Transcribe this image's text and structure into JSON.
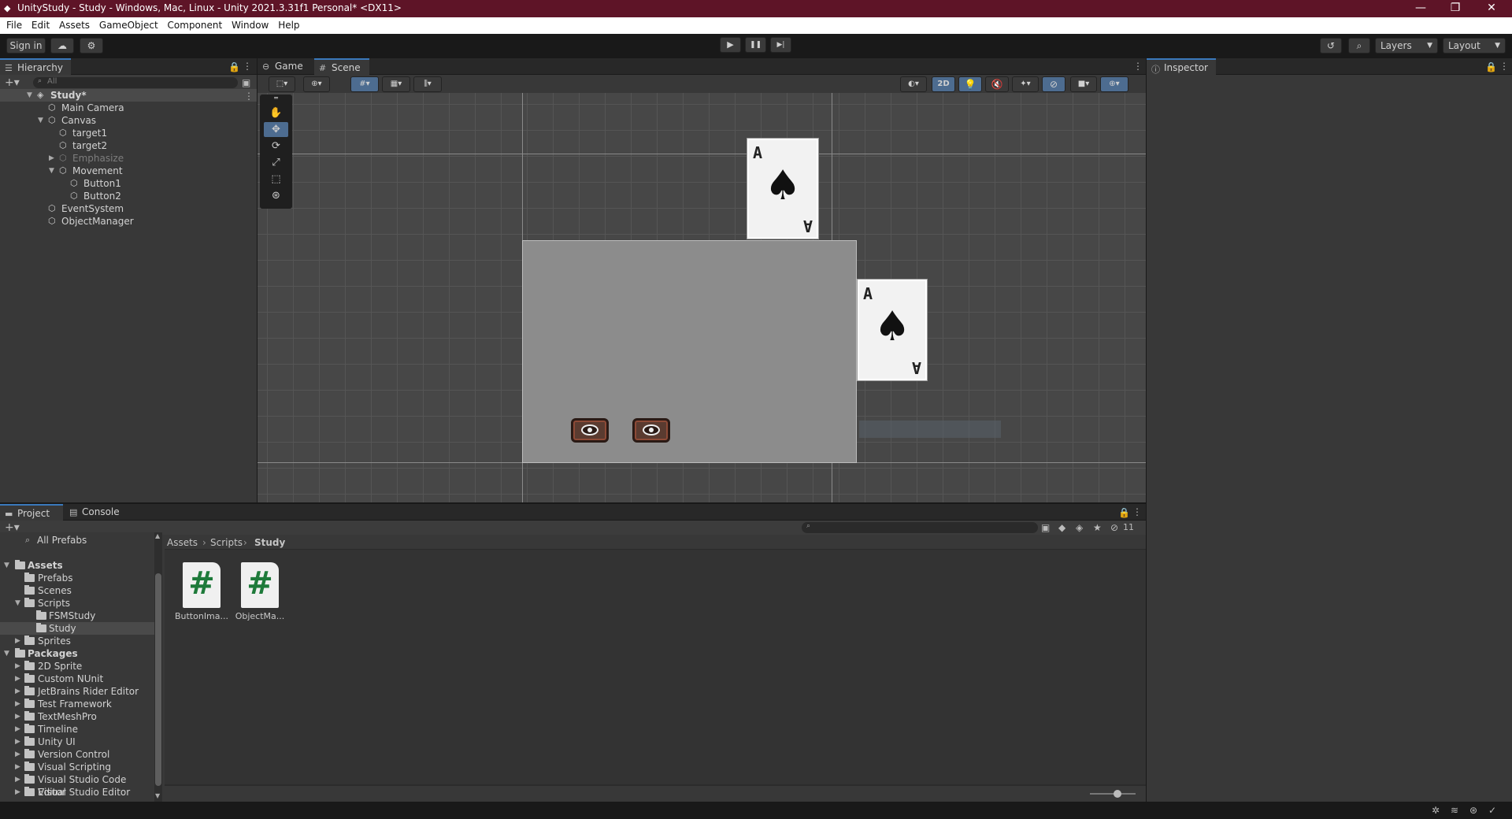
{
  "window": {
    "title": "UnityStudy - Study - Windows, Mac, Linux - Unity 2021.3.31f1 Personal* <DX11>",
    "minimize": "—",
    "restore": "❐",
    "close": "✕"
  },
  "menu": [
    "File",
    "Edit",
    "Assets",
    "GameObject",
    "Component",
    "Window",
    "Help"
  ],
  "toolbar": {
    "sign_in": "Sign in",
    "cloud_icon": "cloud-icon",
    "collab_icon": "collab-icon",
    "play": "▶",
    "pause": "❚❚",
    "step": "▶|",
    "history_icon": "history-icon",
    "search_icon": "search-icon",
    "layers": "Layers",
    "layout": "Layout"
  },
  "hierarchy": {
    "tab": "Hierarchy",
    "search_placeholder": "All",
    "items": [
      {
        "label": "Study*",
        "depth": 0
      },
      {
        "label": "Main Camera",
        "depth": 1
      },
      {
        "label": "Canvas",
        "depth": 1
      },
      {
        "label": "target1",
        "depth": 2
      },
      {
        "label": "target2",
        "depth": 2
      },
      {
        "label": "Emphasize",
        "depth": 2
      },
      {
        "label": "Movement",
        "depth": 2
      },
      {
        "label": "Button1",
        "depth": 3
      },
      {
        "label": "Button2",
        "depth": 3
      },
      {
        "label": "EventSystem",
        "depth": 1
      },
      {
        "label": "ObjectManager",
        "depth": 1
      }
    ]
  },
  "scene": {
    "tabs": [
      "Game",
      "Scene"
    ],
    "mode_2d": "2D",
    "cards": [
      {
        "rank": "A",
        "suit": "♠"
      },
      {
        "rank": "A",
        "suit": "♠"
      }
    ]
  },
  "inspector": {
    "tab": "Inspector"
  },
  "project": {
    "tabs": [
      "Project",
      "Console"
    ],
    "all_prefabs": "All Prefabs",
    "hidden_count": "11",
    "breadcrumb": [
      "Assets",
      "Scripts",
      "Study"
    ],
    "tree": [
      {
        "label": "Assets",
        "depth": 0,
        "bold": true
      },
      {
        "label": "Prefabs",
        "depth": 1
      },
      {
        "label": "Scenes",
        "depth": 1
      },
      {
        "label": "Scripts",
        "depth": 1
      },
      {
        "label": "FSMStudy",
        "depth": 2
      },
      {
        "label": "Study",
        "depth": 2
      },
      {
        "label": "Sprites",
        "depth": 1
      },
      {
        "label": "Packages",
        "depth": 0,
        "bold": true
      },
      {
        "label": "2D Sprite",
        "depth": 1
      },
      {
        "label": "Custom NUnit",
        "depth": 1
      },
      {
        "label": "JetBrains Rider Editor",
        "depth": 1
      },
      {
        "label": "Test Framework",
        "depth": 1
      },
      {
        "label": "TextMeshPro",
        "depth": 1
      },
      {
        "label": "Timeline",
        "depth": 1
      },
      {
        "label": "Unity UI",
        "depth": 1
      },
      {
        "label": "Version Control",
        "depth": 1
      },
      {
        "label": "Visual Scripting",
        "depth": 1
      },
      {
        "label": "Visual Studio Code Editor",
        "depth": 1
      },
      {
        "label": "Visual Studio Editor",
        "depth": 1
      }
    ],
    "files": [
      {
        "name": "ButtonIma...",
        "glyph": "#"
      },
      {
        "name": "ObjectMa...",
        "glyph": "#"
      }
    ]
  }
}
